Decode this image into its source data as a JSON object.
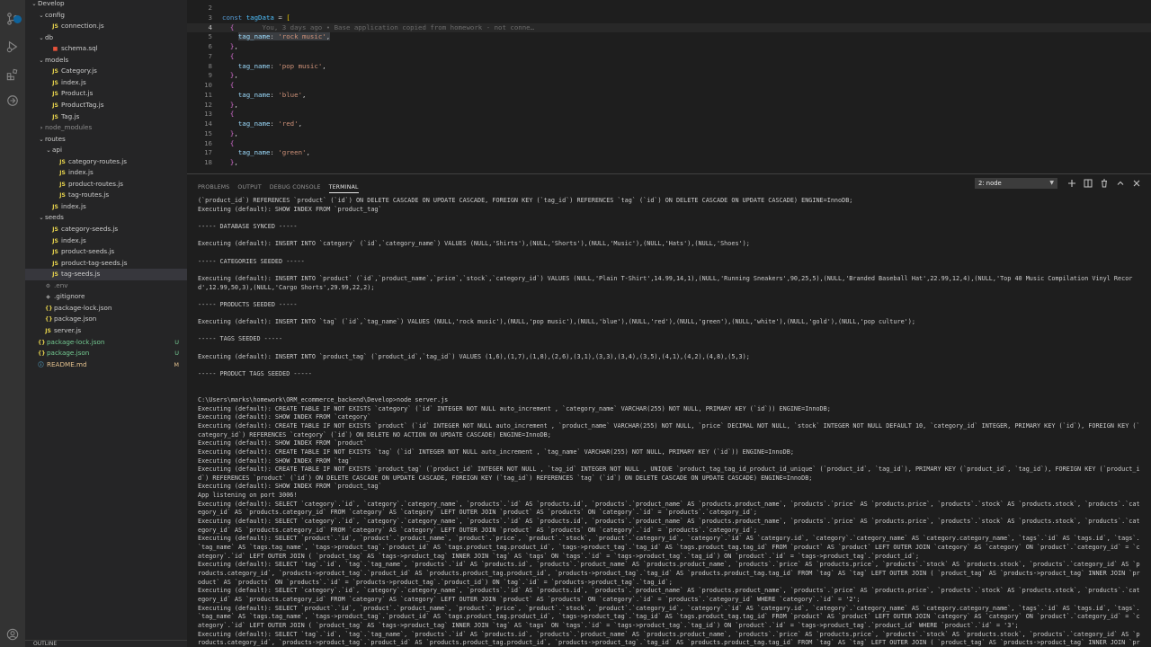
{
  "explorer": {
    "items": [
      {
        "label": "Develop",
        "indent": 0,
        "chev": "v",
        "icon": "",
        "iconColor": "",
        "color": "#cccccc",
        "git": ""
      },
      {
        "label": "config",
        "indent": 1,
        "chev": "v",
        "icon": "",
        "iconColor": "",
        "color": "#cccccc",
        "git": ""
      },
      {
        "label": "connection.js",
        "indent": 2,
        "chev": "",
        "icon": "JS",
        "iconColor": "#e8d44d",
        "color": "#cccccc",
        "git": ""
      },
      {
        "label": "db",
        "indent": 1,
        "chev": "v",
        "icon": "",
        "iconColor": "",
        "color": "#cccccc",
        "git": ""
      },
      {
        "label": "schema.sql",
        "indent": 2,
        "chev": "",
        "icon": "■",
        "iconColor": "#e8533b",
        "color": "#cccccc",
        "git": ""
      },
      {
        "label": "models",
        "indent": 1,
        "chev": "v",
        "icon": "",
        "iconColor": "",
        "color": "#cccccc",
        "git": ""
      },
      {
        "label": "Category.js",
        "indent": 2,
        "chev": "",
        "icon": "JS",
        "iconColor": "#e8d44d",
        "color": "#cccccc",
        "git": ""
      },
      {
        "label": "index.js",
        "indent": 2,
        "chev": "",
        "icon": "JS",
        "iconColor": "#e8d44d",
        "color": "#cccccc",
        "git": ""
      },
      {
        "label": "Product.js",
        "indent": 2,
        "chev": "",
        "icon": "JS",
        "iconColor": "#e8d44d",
        "color": "#cccccc",
        "git": ""
      },
      {
        "label": "ProductTag.js",
        "indent": 2,
        "chev": "",
        "icon": "JS",
        "iconColor": "#e8d44d",
        "color": "#cccccc",
        "git": ""
      },
      {
        "label": "Tag.js",
        "indent": 2,
        "chev": "",
        "icon": "JS",
        "iconColor": "#e8d44d",
        "color": "#cccccc",
        "git": ""
      },
      {
        "label": "node_modules",
        "indent": 1,
        "chev": ">",
        "icon": "",
        "iconColor": "",
        "color": "#8b8b8b",
        "git": ""
      },
      {
        "label": "routes",
        "indent": 1,
        "chev": "v",
        "icon": "",
        "iconColor": "",
        "color": "#cccccc",
        "git": ""
      },
      {
        "label": "api",
        "indent": 2,
        "chev": "v",
        "icon": "",
        "iconColor": "",
        "color": "#cccccc",
        "git": ""
      },
      {
        "label": "category-routes.js",
        "indent": 3,
        "chev": "",
        "icon": "JS",
        "iconColor": "#e8d44d",
        "color": "#cccccc",
        "git": ""
      },
      {
        "label": "index.js",
        "indent": 3,
        "chev": "",
        "icon": "JS",
        "iconColor": "#e8d44d",
        "color": "#cccccc",
        "git": ""
      },
      {
        "label": "product-routes.js",
        "indent": 3,
        "chev": "",
        "icon": "JS",
        "iconColor": "#e8d44d",
        "color": "#cccccc",
        "git": ""
      },
      {
        "label": "tag-routes.js",
        "indent": 3,
        "chev": "",
        "icon": "JS",
        "iconColor": "#e8d44d",
        "color": "#cccccc",
        "git": ""
      },
      {
        "label": "index.js",
        "indent": 2,
        "chev": "",
        "icon": "JS",
        "iconColor": "#e8d44d",
        "color": "#cccccc",
        "git": ""
      },
      {
        "label": "seeds",
        "indent": 1,
        "chev": "v",
        "icon": "",
        "iconColor": "",
        "color": "#cccccc",
        "git": ""
      },
      {
        "label": "category-seeds.js",
        "indent": 2,
        "chev": "",
        "icon": "JS",
        "iconColor": "#e8d44d",
        "color": "#cccccc",
        "git": ""
      },
      {
        "label": "index.js",
        "indent": 2,
        "chev": "",
        "icon": "JS",
        "iconColor": "#e8d44d",
        "color": "#cccccc",
        "git": ""
      },
      {
        "label": "product-seeds.js",
        "indent": 2,
        "chev": "",
        "icon": "JS",
        "iconColor": "#e8d44d",
        "color": "#cccccc",
        "git": ""
      },
      {
        "label": "product-tag-seeds.js",
        "indent": 2,
        "chev": "",
        "icon": "JS",
        "iconColor": "#e8d44d",
        "color": "#cccccc",
        "git": ""
      },
      {
        "label": "tag-seeds.js",
        "indent": 2,
        "chev": "",
        "icon": "JS",
        "iconColor": "#e8d44d",
        "color": "#cccccc",
        "git": "",
        "selected": true
      },
      {
        "label": ".env",
        "indent": 1,
        "chev": "",
        "icon": "⚙",
        "iconColor": "#8b8b8b",
        "color": "#8b8b8b",
        "git": ""
      },
      {
        "label": ".gitignore",
        "indent": 1,
        "chev": "",
        "icon": "◆",
        "iconColor": "#8b8b8b",
        "color": "#cccccc",
        "git": ""
      },
      {
        "label": "package-lock.json",
        "indent": 1,
        "chev": "",
        "icon": "{}",
        "iconColor": "#e8d44d",
        "color": "#cccccc",
        "git": ""
      },
      {
        "label": "package.json",
        "indent": 1,
        "chev": "",
        "icon": "{}",
        "iconColor": "#e8d44d",
        "color": "#cccccc",
        "git": ""
      },
      {
        "label": "server.js",
        "indent": 1,
        "chev": "",
        "icon": "JS",
        "iconColor": "#e8d44d",
        "color": "#cccccc",
        "git": ""
      },
      {
        "label": "package-lock.json",
        "indent": 0,
        "chev": "",
        "icon": "{}",
        "iconColor": "#e8d44d",
        "color": "#73c991",
        "git": "U"
      },
      {
        "label": "package.json",
        "indent": 0,
        "chev": "",
        "icon": "{}",
        "iconColor": "#e8d44d",
        "color": "#73c991",
        "git": "U"
      },
      {
        "label": "README.md",
        "indent": 0,
        "chev": "",
        "icon": "ⓘ",
        "iconColor": "#519aba",
        "color": "#e2c08d",
        "git": "M"
      }
    ],
    "bottom_section": "OUTLINE"
  },
  "editor": {
    "lines": [
      {
        "num": "2",
        "html": ""
      },
      {
        "num": "3",
        "html": "<span class=\"kw\">const</span> <span class=\"var\">tagData</span> <span class=\"pun\">=</span> <span class=\"br1\">[</span>"
      },
      {
        "num": "4",
        "html": "  <span class=\"br2\">{</span>       <span class=\"ghost\">You, 3 days ago • Base application copied from homework - not conne…</span>",
        "current": true
      },
      {
        "num": "5",
        "html": "    <span class=\"hl\"><span class=\"prop\">tag_name</span><span class=\"pun\">:</span> <span class=\"str\">'rock music'</span><span class=\"pun\">,</span></span>"
      },
      {
        "num": "6",
        "html": "  <span class=\"br2\">}</span><span class=\"pun\">,</span>"
      },
      {
        "num": "7",
        "html": "  <span class=\"br2\">{</span>"
      },
      {
        "num": "8",
        "html": "    <span class=\"prop\">tag_name</span><span class=\"pun\">:</span> <span class=\"str\">'pop music'</span><span class=\"pun\">,</span>"
      },
      {
        "num": "9",
        "html": "  <span class=\"br2\">}</span><span class=\"pun\">,</span>"
      },
      {
        "num": "10",
        "html": "  <span class=\"br2\">{</span>"
      },
      {
        "num": "11",
        "html": "    <span class=\"prop\">tag_name</span><span class=\"pun\">:</span> <span class=\"str\">'blue'</span><span class=\"pun\">,</span>"
      },
      {
        "num": "12",
        "html": "  <span class=\"br2\">}</span><span class=\"pun\">,</span>"
      },
      {
        "num": "13",
        "html": "  <span class=\"br2\">{</span>"
      },
      {
        "num": "14",
        "html": "    <span class=\"prop\">tag_name</span><span class=\"pun\">:</span> <span class=\"str\">'red'</span><span class=\"pun\">,</span>"
      },
      {
        "num": "15",
        "html": "  <span class=\"br2\">}</span><span class=\"pun\">,</span>"
      },
      {
        "num": "16",
        "html": "  <span class=\"br2\">{</span>"
      },
      {
        "num": "17",
        "html": "    <span class=\"prop\">tag_name</span><span class=\"pun\">:</span> <span class=\"str\">'green'</span><span class=\"pun\">,</span>"
      },
      {
        "num": "18",
        "html": "  <span class=\"br2\">}</span><span class=\"pun\">,</span>"
      }
    ]
  },
  "panel": {
    "tabs": [
      {
        "label": "PROBLEMS",
        "active": false
      },
      {
        "label": "OUTPUT",
        "active": false
      },
      {
        "label": "DEBUG CONSOLE",
        "active": false
      },
      {
        "label": "TERMINAL",
        "active": true
      }
    ],
    "terminal_select": "2: node",
    "terminal_lines": [
      "(`product_id`) REFERENCES `product` (`id`) ON DELETE CASCADE ON UPDATE CASCADE, FOREIGN KEY (`tag_id`) REFERENCES `tag` (`id`) ON DELETE CASCADE ON UPDATE CASCADE) ENGINE=InnoDB;",
      "Executing (default): SHOW INDEX FROM `product_tag`",
      "",
      "----- DATABASE SYNCED -----",
      "",
      "Executing (default): INSERT INTO `category` (`id`,`category_name`) VALUES (NULL,'Shirts'),(NULL,'Shorts'),(NULL,'Music'),(NULL,'Hats'),(NULL,'Shoes');",
      "",
      "----- CATEGORIES SEEDED -----",
      "",
      "Executing (default): INSERT INTO `product` (`id`,`product_name`,`price`,`stock`,`category_id`) VALUES (NULL,'Plain T-Shirt',14.99,14,1),(NULL,'Running Sneakers',90,25,5),(NULL,'Branded Baseball Hat',22.99,12,4),(NULL,'Top 40 Music Compilation Vinyl Record',12.99,50,3),(NULL,'Cargo Shorts',29.99,22,2);",
      "",
      "----- PRODUCTS SEEDED -----",
      "",
      "Executing (default): INSERT INTO `tag` (`id`,`tag_name`) VALUES (NULL,'rock music'),(NULL,'pop music'),(NULL,'blue'),(NULL,'red'),(NULL,'green'),(NULL,'white'),(NULL,'gold'),(NULL,'pop culture');",
      "",
      "----- TAGS SEEDED -----",
      "",
      "Executing (default): INSERT INTO `product_tag` (`product_id`,`tag_id`) VALUES (1,6),(1,7),(1,8),(2,6),(3,1),(3,3),(3,4),(3,5),(4,1),(4,2),(4,8),(5,3);",
      "",
      "----- PRODUCT TAGS SEEDED -----",
      "",
      "",
      "C:\\Users\\marks\\homework\\ORM_ecommerce_backend\\Develop>node server.js",
      "Executing (default): CREATE TABLE IF NOT EXISTS `category` (`id` INTEGER NOT NULL auto_increment , `category_name` VARCHAR(255) NOT NULL, PRIMARY KEY (`id`)) ENGINE=InnoDB;",
      "Executing (default): SHOW INDEX FROM `category`",
      "Executing (default): CREATE TABLE IF NOT EXISTS `product` (`id` INTEGER NOT NULL auto_increment , `product_name` VARCHAR(255) NOT NULL, `price` DECIMAL NOT NULL, `stock` INTEGER NOT NULL DEFAULT 10, `category_id` INTEGER, PRIMARY KEY (`id`), FOREIGN KEY (`category_id`) REFERENCES `category` (`id`) ON DELETE NO ACTION ON UPDATE CASCADE) ENGINE=InnoDB;",
      "Executing (default): SHOW INDEX FROM `product`",
      "Executing (default): CREATE TABLE IF NOT EXISTS `tag` (`id` INTEGER NOT NULL auto_increment , `tag_name` VARCHAR(255) NOT NULL, PRIMARY KEY (`id`)) ENGINE=InnoDB;",
      "Executing (default): SHOW INDEX FROM `tag`",
      "Executing (default): CREATE TABLE IF NOT EXISTS `product_tag` (`product_id` INTEGER NOT NULL , `tag_id` INTEGER NOT NULL , UNIQUE `product_tag_tag_id_product_id_unique` (`product_id`, `tag_id`), PRIMARY KEY (`product_id`, `tag_id`), FOREIGN KEY (`product_id`) REFERENCES `product` (`id`) ON DELETE CASCADE ON UPDATE CASCADE, FOREIGN KEY (`tag_id`) REFERENCES `tag` (`id`) ON DELETE CASCADE ON UPDATE CASCADE) ENGINE=InnoDB;",
      "Executing (default): SHOW INDEX FROM `product_tag`",
      "App listening on port 3006!",
      "Executing (default): SELECT `category`.`id`, `category`.`category_name`, `products`.`id` AS `products.id`, `products`.`product_name` AS `products.product_name`, `products`.`price` AS `products.price`, `products`.`stock` AS `products.stock`, `products`.`category_id` AS `products.category_id` FROM `category` AS `category` LEFT OUTER JOIN `product` AS `products` ON `category`.`id` = `products`.`category_id`;",
      "Executing (default): SELECT `category`.`id`, `category`.`category_name`, `products`.`id` AS `products.id`, `products`.`product_name` AS `products.product_name`, `products`.`price` AS `products.price`, `products`.`stock` AS `products.stock`, `products`.`category_id` AS `products.category_id` FROM `category` AS `category` LEFT OUTER JOIN `product` AS `products` ON `category`.`id` = `products`.`category_id`;",
      "Executing (default): SELECT `product`.`id`, `product`.`product_name`, `product`.`price`, `product`.`stock`, `product`.`category_id`, `category`.`id` AS `category.id`, `category`.`category_name` AS `category.category_name`, `tags`.`id` AS `tags.id`, `tags`.`tag_name` AS `tags.tag_name`, `tags->product_tag`.`product_id` AS `tags.product_tag.product_id`, `tags->product_tag`.`tag_id` AS `tags.product_tag.tag_id` FROM `product` AS `product` LEFT OUTER JOIN `category` AS `category` ON `product`.`category_id` = `category`.`id` LEFT OUTER JOIN ( `product_tag` AS `tags->product_tag` INNER JOIN `tag` AS `tags` ON `tags`.`id` = `tags->product_tag`.`tag_id`) ON `product`.`id` = `tags->product_tag`.`product_id`;",
      "Executing (default): SELECT `tag`.`id`, `tag`.`tag_name`, `products`.`id` AS `products.id`, `products`.`product_name` AS `products.product_name`, `products`.`price` AS `products.price`, `products`.`stock` AS `products.stock`, `products`.`category_id` AS `products.category_id`, `products->product_tag`.`product_id` AS `products.product_tag.product_id`, `products->product_tag`.`tag_id` AS `products.product_tag.tag_id` FROM `tag` AS `tag` LEFT OUTER JOIN ( `product_tag` AS `products->product_tag` INNER JOIN `product` AS `products` ON `products`.`id` = `products->product_tag`.`product_id`) ON `tag`.`id` = `products->product_tag`.`tag_id`;",
      "Executing (default): SELECT `category`.`id`, `category`.`category_name`, `products`.`id` AS `products.id`, `products`.`product_name` AS `products.product_name`, `products`.`price` AS `products.price`, `products`.`stock` AS `products.stock`, `products`.`category_id` AS `products.category_id` FROM `category` AS `category` LEFT OUTER JOIN `product` AS `products` ON `category`.`id` = `products`.`category_id` WHERE `category`.`id` = '2';",
      "Executing (default): SELECT `product`.`id`, `product`.`product_name`, `product`.`price`, `product`.`stock`, `product`.`category_id`, `category`.`id` AS `category.id`, `category`.`category_name` AS `category.category_name`, `tags`.`id` AS `tags.id`, `tags`.`tag_name` AS `tags.tag_name`, `tags->product_tag`.`product_id` AS `tags.product_tag.product_id`, `tags->product_tag`.`tag_id` AS `tags.product_tag.tag_id` FROM `product` AS `product` LEFT OUTER JOIN `category` AS `category` ON `product`.`category_id` = `category`.`id` LEFT OUTER JOIN ( `product_tag` AS `tags->product_tag` INNER JOIN `tag` AS `tags` ON `tags`.`id` = `tags->product_tag`.`tag_id`) ON `product`.`id` = `tags->product_tag`.`product_id` WHERE `product`.`id` = '3';",
      "Executing (default): SELECT `tag`.`id`, `tag`.`tag_name`, `products`.`id` AS `products.id`, `products`.`product_name` AS `products.product_name`, `products`.`price` AS `products.price`, `products`.`stock` AS `products.stock`, `products`.`category_id` AS `products.category_id`, `products->product_tag`.`product_id` AS `products.product_tag.product_id`, `products->product_tag`.`tag_id` AS `products.product_tag.tag_id` FROM `tag` AS `tag` LEFT OUTER JOIN ( `product_tag` AS `products->product_tag` INNER JOIN `product` AS `products` ON `products`.`id` = `products->product_tag`.`product_id`) ON `tag`.`id` = `products->product_tag`.`tag_id`;"
    ]
  },
  "colors": {
    "accent": "#0e639c",
    "sidebar_bg": "#252526",
    "editor_bg": "#1e1e1e",
    "activity_bg": "#333333"
  }
}
